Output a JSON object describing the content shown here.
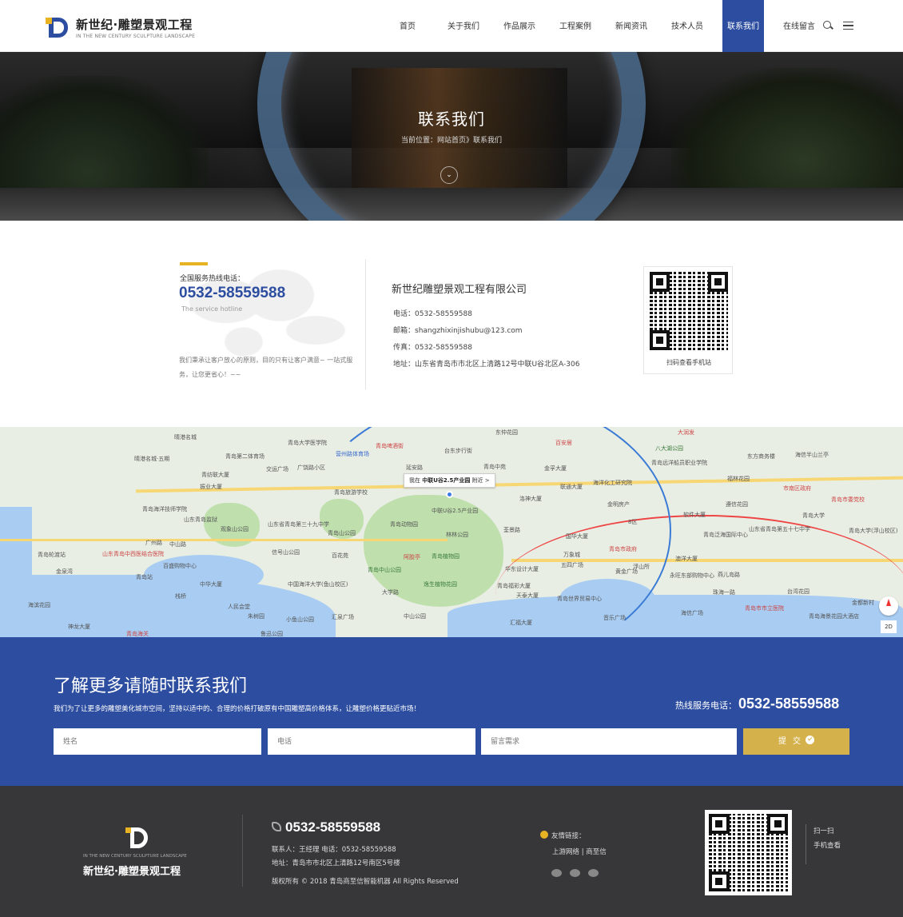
{
  "header": {
    "logo_cn": "新世纪·雕塑景观工程",
    "logo_en": "IN THE NEW CENTURY SCULPTURE LANDSCAPE",
    "nav": [
      "首页",
      "关于我们",
      "作品展示",
      "工程案例",
      "新闻资讯",
      "技术人员",
      "联系我们",
      "在线留言"
    ],
    "active_nav": "联系我们",
    "icons": [
      "search-icon",
      "menu-icon"
    ]
  },
  "banner": {
    "title": "联系我们",
    "breadcrumb": "当前位置：网站首页》联系我们",
    "down_glyph": "⌄"
  },
  "contact": {
    "hotline_label": "全国服务热线电话：",
    "hotline": "0532-58559588",
    "hotline_en": "The service hotline",
    "slogan": "我们秉承让客户放心的原则，目的只有让客户满意~ 一站式服务，让您更省心！~~",
    "company": "新世纪雕塑景观工程有限公司",
    "phone": "电话：0532-58559588",
    "email": "邮箱：shangzhixinjishubu@123.com",
    "fax": "传真：0532-58559588",
    "address": "地址：山东省青岛市市北区上清路12号中联U谷北区A-306",
    "qr_caption": "扫码查看手机站"
  },
  "map": {
    "tip_prefix": "我在",
    "tip_place": "中联U谷2.5产业园",
    "tip_suffix": "附近 >",
    "scale_label": "2D",
    "labels": [
      "晴港名城",
      "晴港名城·五期",
      "青岛第二体育场",
      "青岛大学医学院",
      "营州路体育场",
      "青岛啤酒街",
      "台东步行街",
      "东仲花园",
      "百安居",
      "大润发",
      "八大湖公园",
      "东方商务楼",
      "海信半山兰亭",
      "交运广场",
      "广饶路小区",
      "延安路",
      "青岛中苑",
      "青纺联大厦",
      "振业大厦",
      "青岛旅游学校",
      "金孚大厦",
      "联通大厦",
      "海洋化工研究院",
      "青岛远洋船员职业学院",
      "福林花园",
      "市南区政府",
      "青岛市委党校",
      "青岛海洋技师学院",
      "山东青岛监狱",
      "山东省青岛第三十九中学",
      "中联U谷2.5产业园",
      "洛神大厦",
      "金明房产",
      "遵信花园",
      "青岛大学",
      "山东省青岛第五十七中学",
      "青岛大学(浮山校区)",
      "广州路",
      "观象山公园",
      "青岛山公园",
      "青岛动物园",
      "林林公园",
      "荃景路",
      "国华大厦",
      "8区",
      "软件大厦",
      "青岛泛海国际中心",
      "中山路",
      "信号山公园",
      "百花苑",
      "阿胶亭",
      "青岛植物园",
      "万象城",
      "五四广场",
      "青岛市政府",
      "浮山所",
      "澳洋大厦",
      "燕儿岛路",
      "青岛站",
      "百盛购物中心",
      "青岛中山公园",
      "华东设计大厦",
      "黄金广场",
      "永旺东部购物中心",
      "中国海洋大学(鱼山校区)",
      "中华大厦",
      "逸生植物花园",
      "青岛福彩大厦",
      "大学路",
      "天泰大厦",
      "珠海一路",
      "台湾花园",
      "金都新村",
      "金泉湾",
      "海滨花园",
      "栈桥",
      "人民会堂",
      "朱树园",
      "青岛世界贸易中心",
      "海信广场",
      "青岛市市立医院",
      "青岛海景花园大酒店",
      "神龙大厦",
      "汇泉广场",
      "中山公园",
      "汇福大厦",
      "音乐广场",
      "小鱼山公园",
      "鲁迅公园",
      "青岛海关",
      "青岛轮渡站",
      "山东青岛中西医结合医院"
    ]
  },
  "cta": {
    "title": "了解更多请随时联系我们",
    "desc": "我们为了让更多的雕塑美化城市空间，坚持以适中的、合理的价格打破原有中国雕塑高价格体系，让雕塑价格更贴近市场！",
    "hotline_label": "热线服务电话：",
    "hotline": "0532-58559588",
    "name_placeholder": "姓名",
    "phone_placeholder": "电话",
    "message_placeholder": "留言需求",
    "submit": "提交"
  },
  "footer": {
    "logo_en": "IN THE NEW CENTURY SCULPTURE LANDSCAPE",
    "logo_cn": "新世纪·雕塑景观工程",
    "phone": "0532-58559588",
    "contact_line": "联系人：王经理    电话：0532-58559588",
    "address": "地址：青岛市市北区上清路12号南区5号楼",
    "copyright": "版权所有 © 2018 青岛商至信智能机器 All Rights Reserved",
    "links_title": "友情链接：",
    "links": [
      "上游网络",
      "商至信"
    ],
    "link_sep": "|",
    "scan_1": "扫一扫",
    "scan_2": "手机查看"
  }
}
